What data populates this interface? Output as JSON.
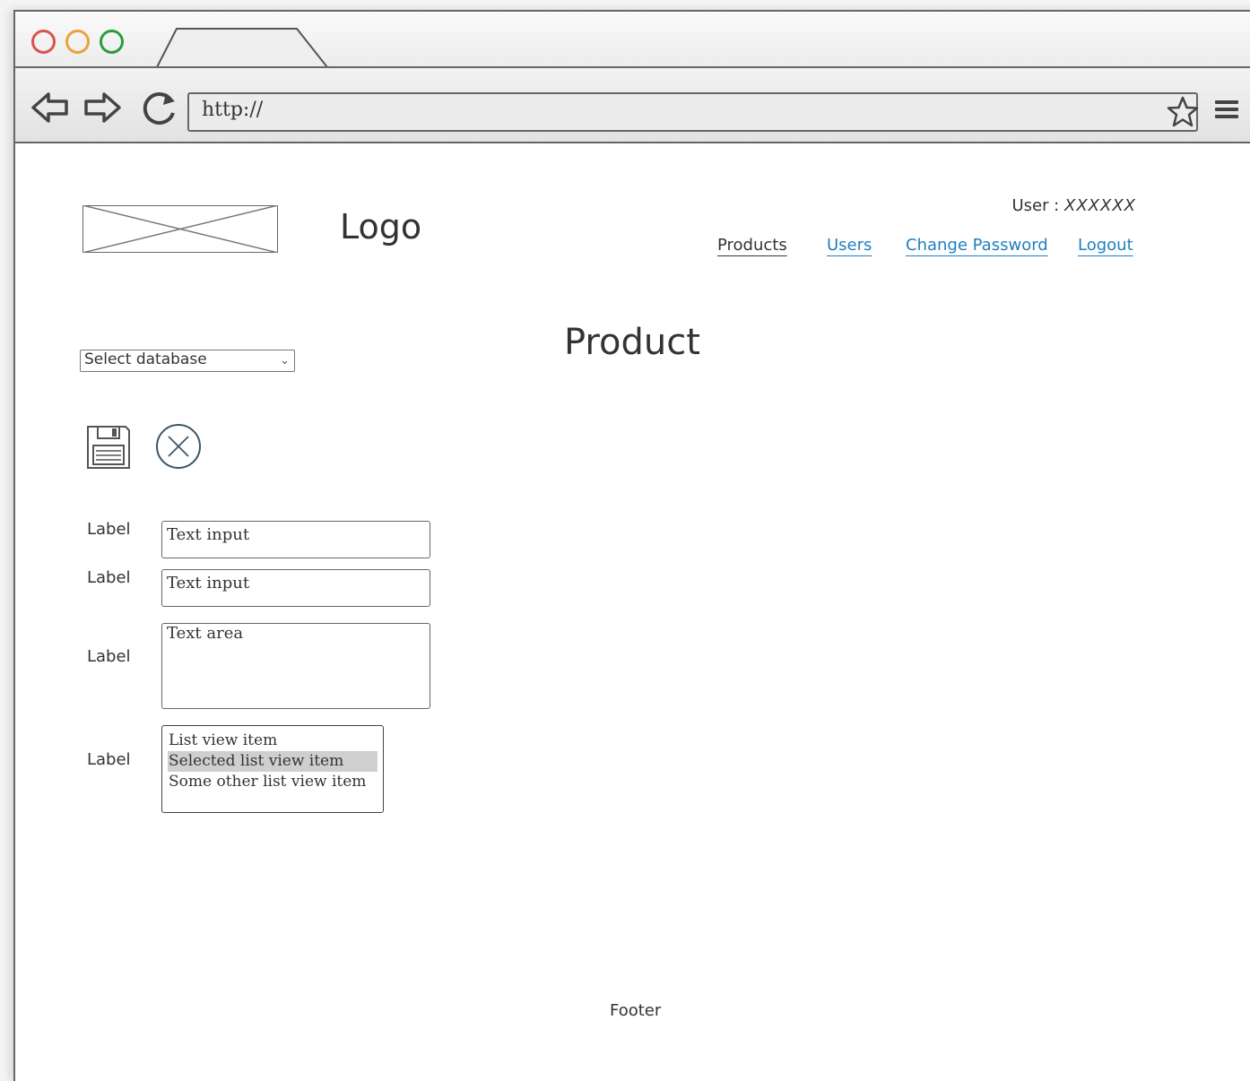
{
  "browser": {
    "url": "http://"
  },
  "header": {
    "logo_text": "Logo",
    "user_label": "User :",
    "user_value": "XXXXXX",
    "nav": [
      {
        "label": "Products"
      },
      {
        "label": "Users"
      },
      {
        "label": "Change Password"
      },
      {
        "label": "Logout"
      }
    ]
  },
  "main": {
    "title": "Product",
    "database_select": "Select database",
    "form": {
      "fields": [
        {
          "label": "Label",
          "value": "Text input"
        },
        {
          "label": "Label",
          "value": "Text input"
        },
        {
          "label": "Label",
          "value": "Text area"
        },
        {
          "label": "Label"
        }
      ],
      "list_items": [
        {
          "text": "List view item",
          "selected": false
        },
        {
          "text": "Selected list view item",
          "selected": true
        },
        {
          "text": "Some other list view item",
          "selected": false
        }
      ]
    }
  },
  "footer": {
    "text": "Footer"
  },
  "colors": {
    "link": "#1f7fc1",
    "selected_item": "#cfcfcf",
    "close_red": "#d9534f",
    "minimize_orange": "#e8a33b",
    "maximize_green": "#2a9d3a"
  }
}
